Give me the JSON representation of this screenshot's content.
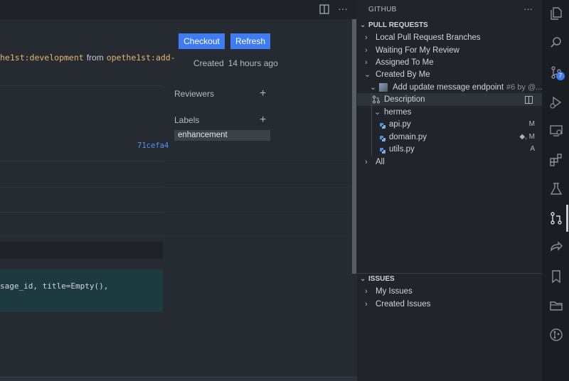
{
  "editor": {
    "checkout_label": "Checkout",
    "refresh_label": "Refresh",
    "branch_source": "he1st:development",
    "branch_from_word": "from",
    "branch_target": "opethe1st:add-",
    "created_label": "Created",
    "created_time": "14 hours ago",
    "reviewers_label": "Reviewers",
    "labels_label": "Labels",
    "label_tag": "enhancement",
    "commit_hash": "71cefa4",
    "code_line": "sage_id, title=Empty(),"
  },
  "sidebar": {
    "title": "GITHUB",
    "pull_requests": {
      "header": "PULL REQUESTS",
      "items": [
        {
          "label": "Local Pull Request Branches"
        },
        {
          "label": "Waiting For My Review"
        },
        {
          "label": "Assigned To Me"
        },
        {
          "label": "Created By Me"
        }
      ],
      "pr": {
        "title": "Add update message endpoint",
        "meta": "#6 by @...",
        "description_label": "Description",
        "folder": "hermes",
        "files": [
          {
            "name": "api.py",
            "status": "M"
          },
          {
            "name": "domain.py",
            "status": "◆, M"
          },
          {
            "name": "utils.py",
            "status": "A"
          }
        ]
      },
      "all_label": "All"
    },
    "issues": {
      "header": "ISSUES",
      "items": [
        {
          "label": "My Issues"
        },
        {
          "label": "Created Issues"
        }
      ]
    }
  },
  "activity_bar": {
    "icons": [
      "explorer-icon",
      "search-icon",
      "source-control-icon",
      "run-debug-icon",
      "remote-explorer-icon",
      "extensions-icon",
      "testing-icon",
      "pull-requests-icon",
      "live-share-icon",
      "bookmarks-icon",
      "folder-icon",
      "git-graph-icon"
    ],
    "source_control_badge": "7"
  }
}
